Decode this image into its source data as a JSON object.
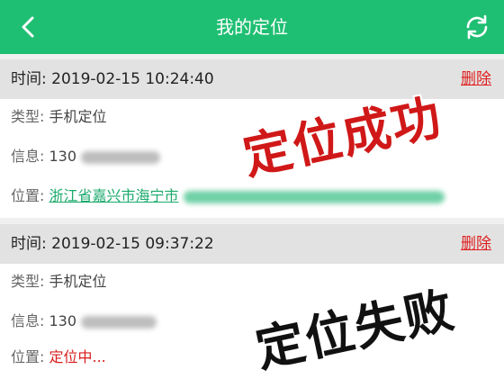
{
  "header": {
    "title": "我的定位",
    "back_icon": "chevron-left-icon",
    "refresh_icon": "refresh-icon",
    "color": "#1fbf73"
  },
  "records": [
    {
      "time_label": "时间:",
      "time": "2019-02-15 10:24:40",
      "delete_label": "删除",
      "type_label": "类型:",
      "type": "手机定位",
      "info_label": "信息:",
      "info": "130",
      "location_label": "位置:",
      "location": "浙江省嘉兴市海宁市",
      "stamp": "定位成功"
    },
    {
      "time_label": "时间:",
      "time": "2019-02-15 09:37:22",
      "delete_label": "删除",
      "type_label": "类型:",
      "type": "手机定位",
      "info_label": "信息:",
      "info": "130",
      "location_label": "位置:",
      "location": "定位中...",
      "stamp": "定位失败"
    }
  ]
}
